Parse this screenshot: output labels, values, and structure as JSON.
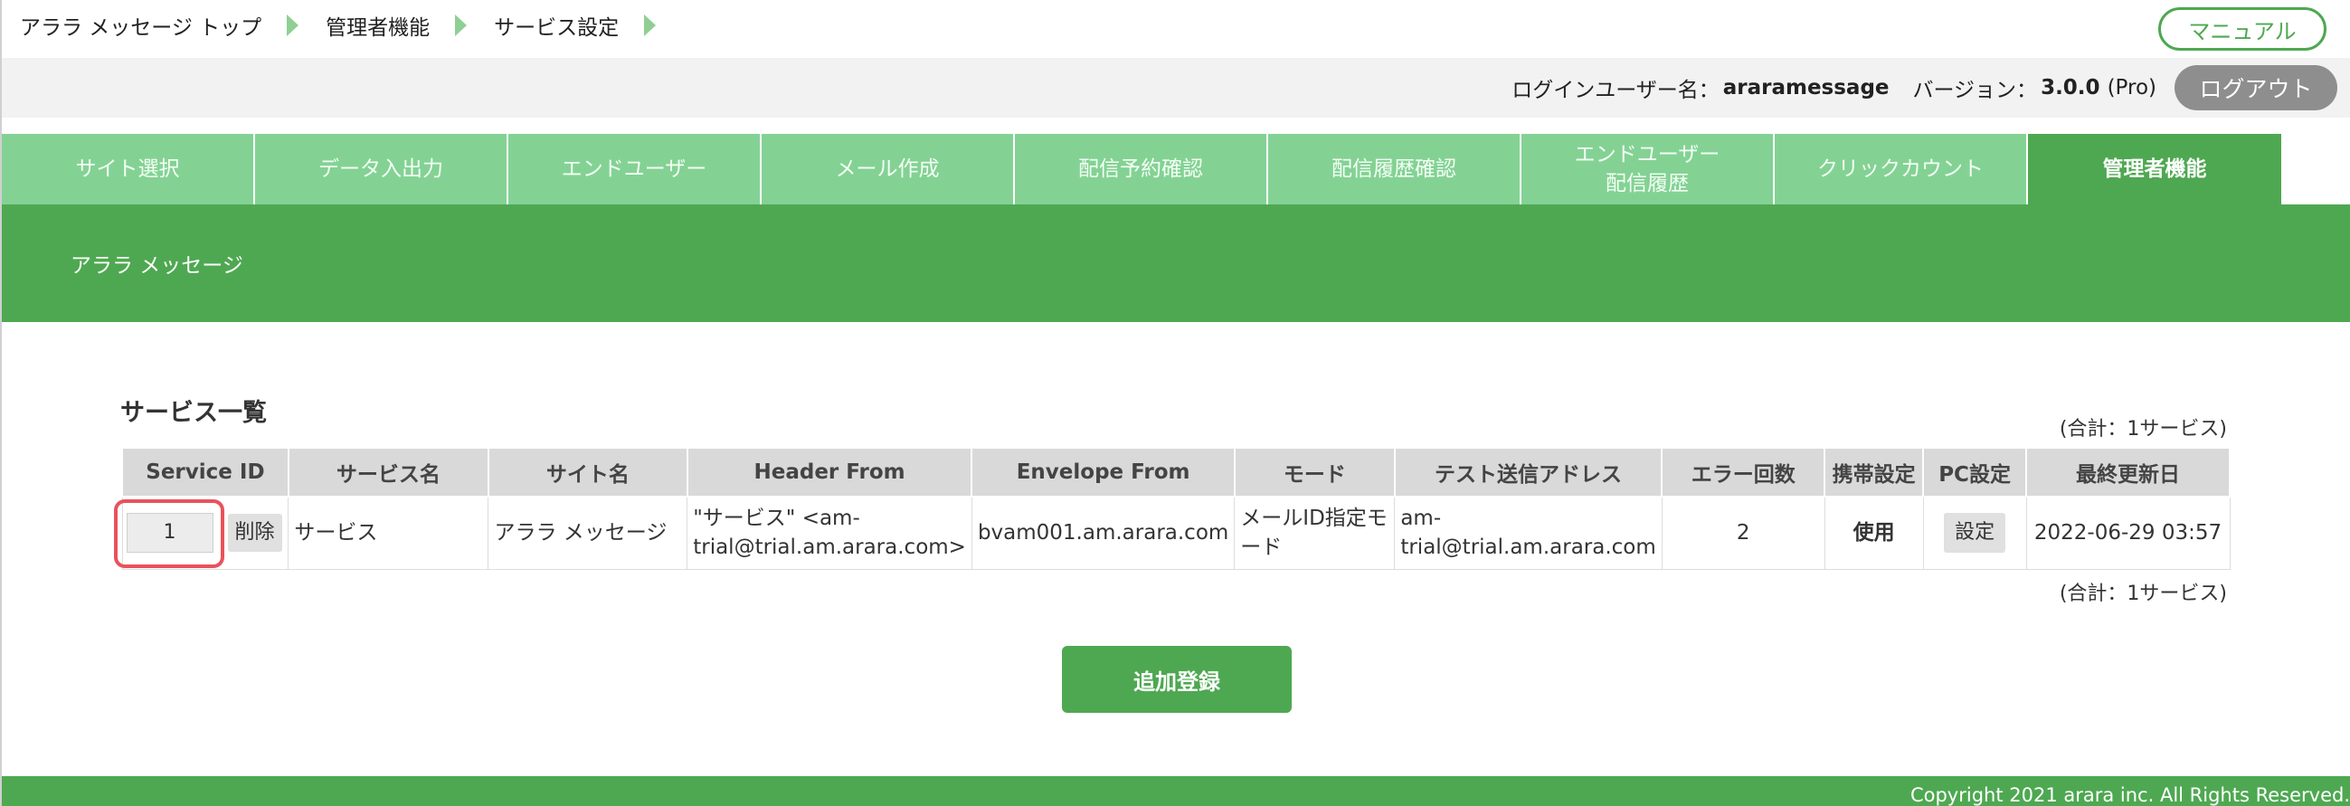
{
  "breadcrumb": [
    "アララ メッセージ トップ",
    "管理者機能",
    "サービス設定"
  ],
  "manual_label": "マニュアル",
  "userbar": {
    "login_label": "ログインユーザー名：",
    "login_user": "araramessage",
    "version_label": "バージョン：",
    "version": "3.0.0",
    "edition": "(Pro)",
    "logout_label": "ログアウト"
  },
  "tabs": [
    {
      "label": "サイト選択"
    },
    {
      "label": "データ入出力"
    },
    {
      "label": "エンドユーザー"
    },
    {
      "label": "メール作成"
    },
    {
      "label": "配信予約確認"
    },
    {
      "label": "配信履歴確認"
    },
    {
      "label": "エンドユーザー\n配信履歴"
    },
    {
      "label": "クリックカウント"
    },
    {
      "label": "管理者機能"
    }
  ],
  "site_name": "アララ メッセージ",
  "section_title": "サービス一覧",
  "total_label": "(合計：1サービス)",
  "table": {
    "headers": [
      "Service ID",
      "サービス名",
      "サイト名",
      "Header From",
      "Envelope From",
      "モード",
      "テスト送信アドレス",
      "エラー回数",
      "携帯設定",
      "PC設定",
      "最終更新日"
    ],
    "rows": [
      {
        "service_id": "1",
        "delete_label": "削除",
        "service_name": "サービス",
        "site_name": "アララ メッセージ",
        "header_from": "\"サービス\" <am-trial@trial.am.arara.com>",
        "envelope_from": "bvam001.am.arara.com",
        "mode": "メールID指定モード",
        "test_address": "am-trial@trial.am.arara.com",
        "error_count": "2",
        "mobile_setting": "使用",
        "pc_setting_label": "設定",
        "last_updated": "2022-06-29 03:57"
      }
    ]
  },
  "add_button_label": "追加登録",
  "footer": "Copyright 2021 arara inc. All Rights Reserved.",
  "colors": {
    "brand_green": "#4ea851",
    "tab_green": "#83d294",
    "highlight_red": "#e8525c"
  }
}
